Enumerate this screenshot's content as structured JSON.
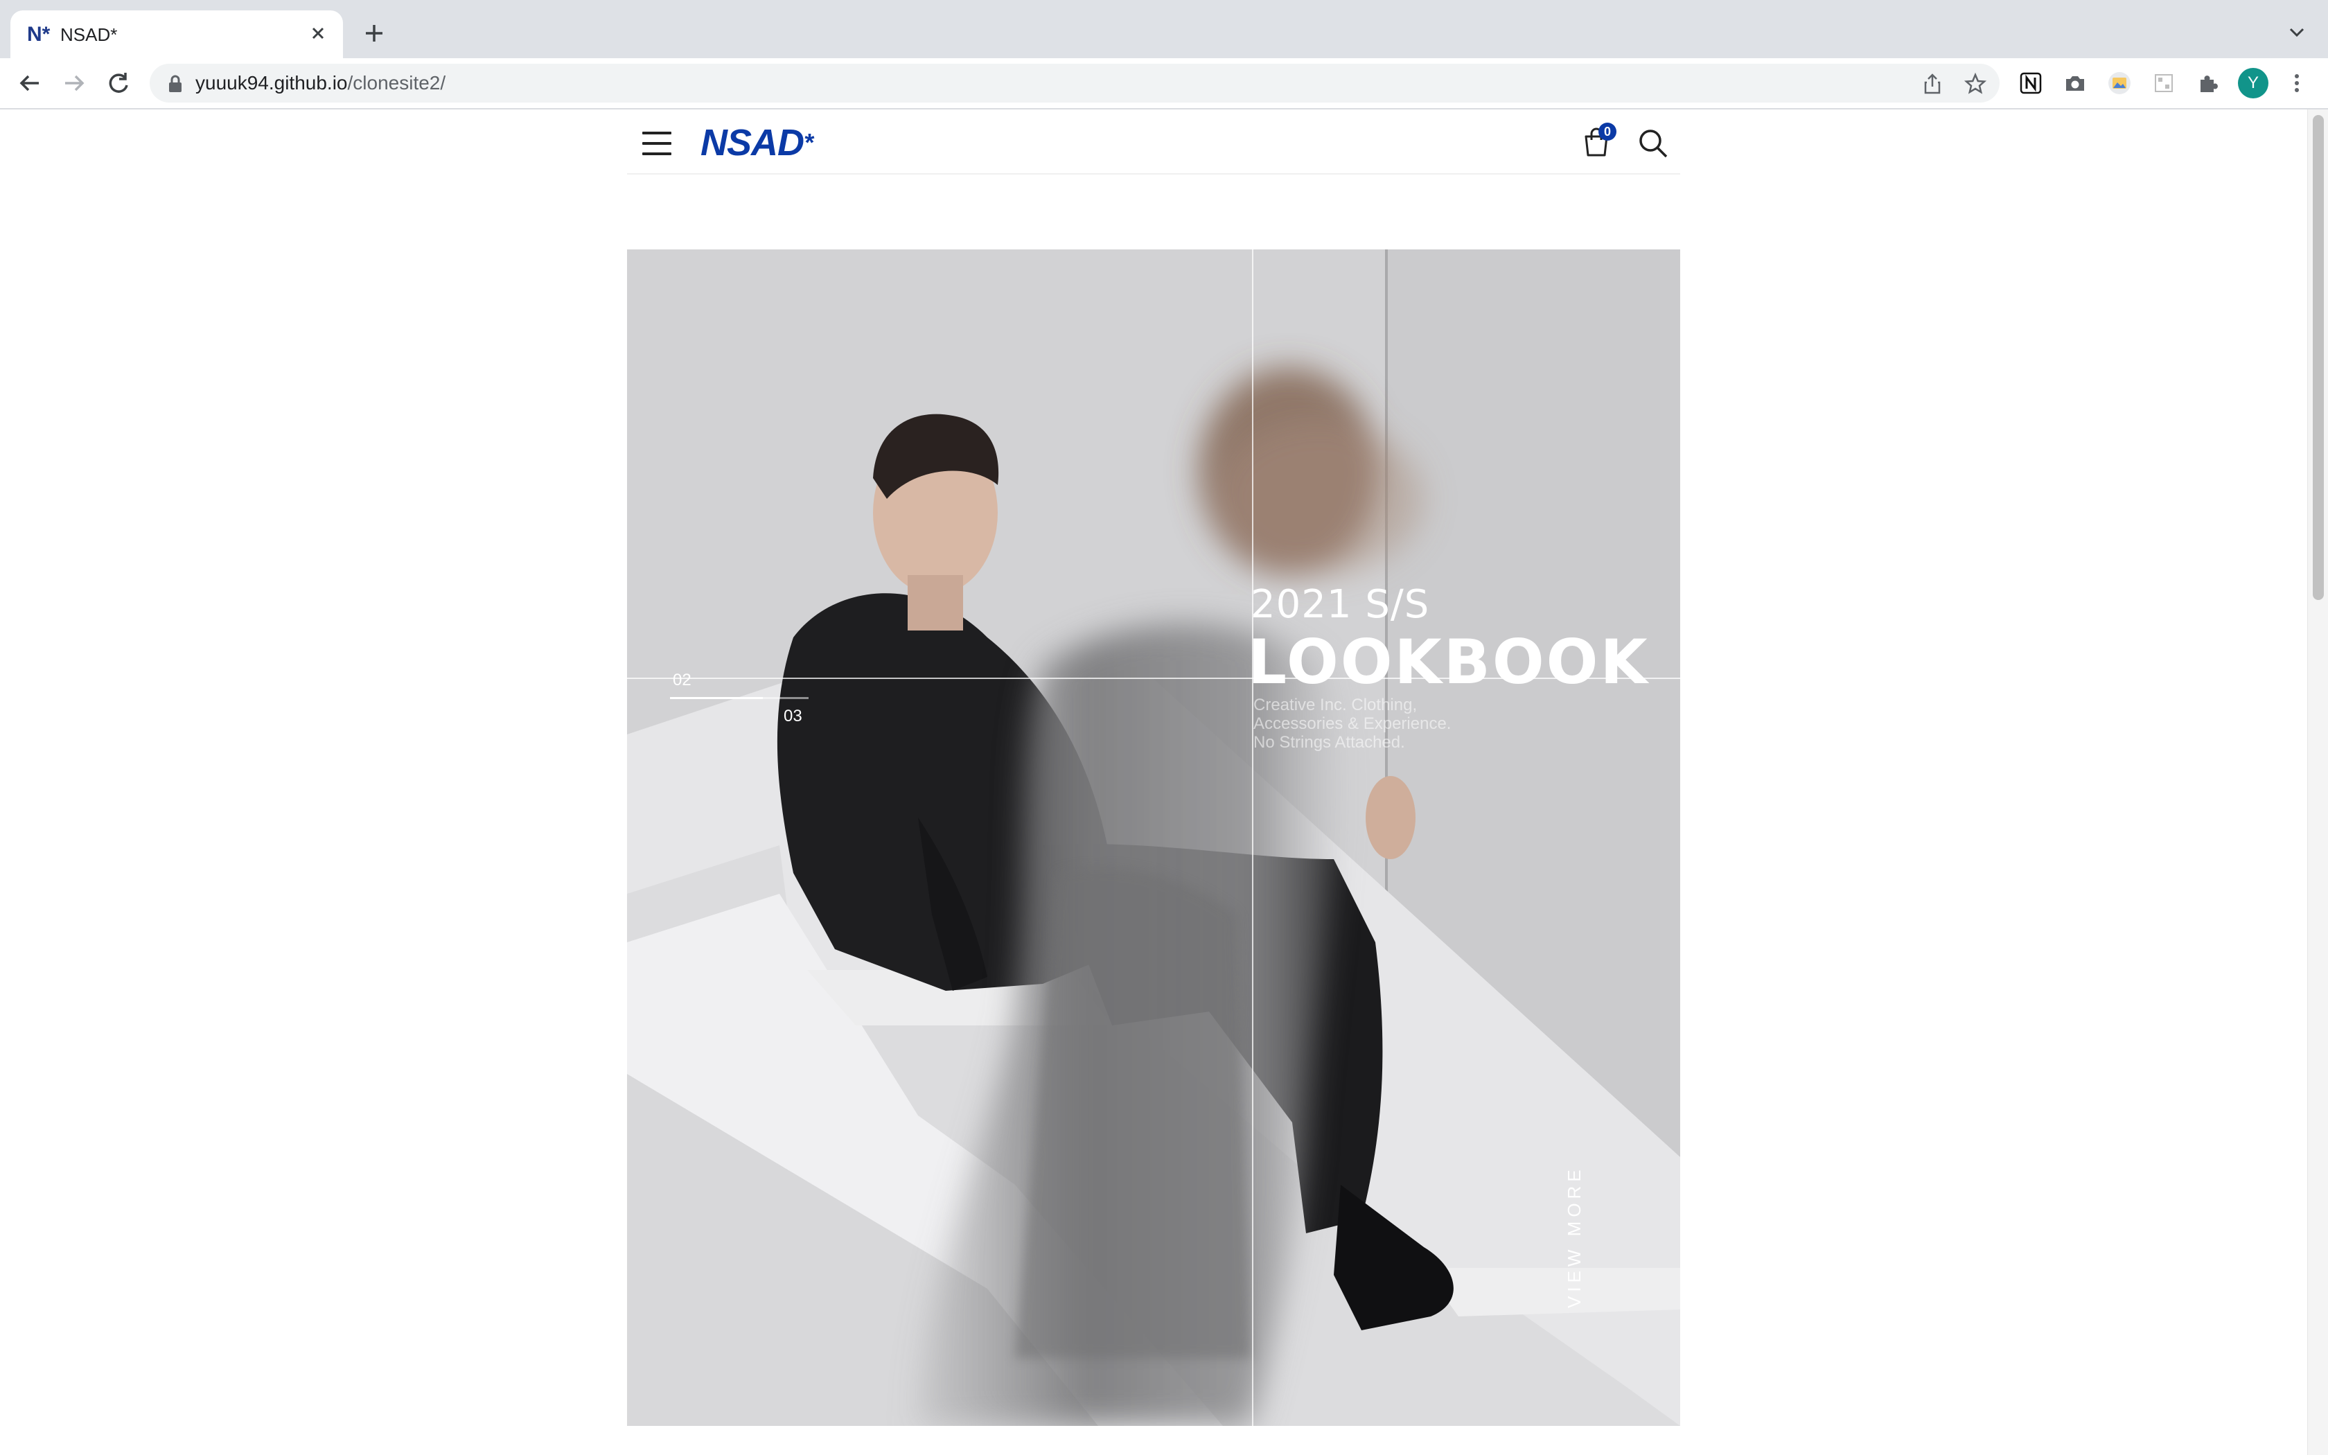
{
  "browser": {
    "tab_title": "NSAD*",
    "tab_favicon": "N*",
    "url_host": "yuuuk94.github.io",
    "url_path": "/clonesite2/",
    "profile_initial": "Y",
    "icons": [
      "back-icon",
      "forward-icon",
      "reload-icon",
      "lock-icon",
      "share-icon",
      "star-icon",
      "notion-icon",
      "camera-icon",
      "image-icon",
      "puzzle-icon",
      "kebab-menu-icon"
    ]
  },
  "site": {
    "logo": "NSAD",
    "logo_mark": "*",
    "cart_count": "0",
    "brand_color": "#0b3aa6"
  },
  "hero": {
    "slide_current": "02",
    "slide_total": "03",
    "slide_progress": 0.67,
    "season": "2021 S/S",
    "title": "LOOKBOOK",
    "tagline_lines": [
      "Creative Inc. Clothing,",
      "Accessories & Experience.",
      "No Strings Attached."
    ],
    "cta": "VIEW MORE"
  }
}
